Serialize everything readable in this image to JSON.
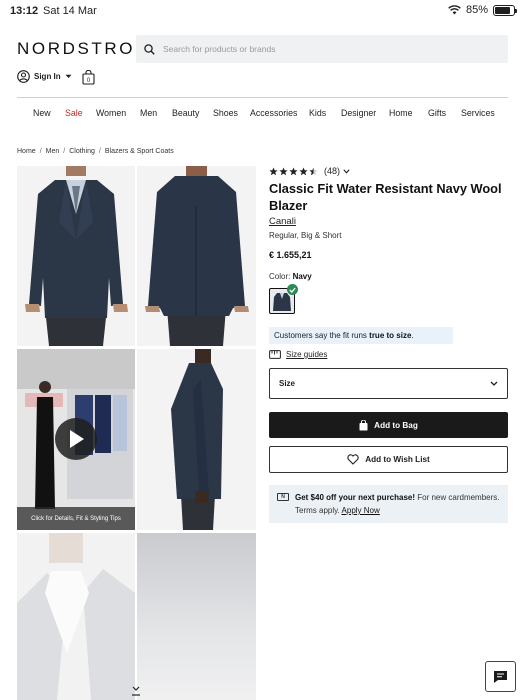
{
  "status_bar": {
    "time": "13:12",
    "date": "Sat 14 Mar",
    "battery": "85%"
  },
  "header": {
    "logo": "NORDSTROM",
    "search_placeholder": "Search for products or brands",
    "sign_in": "Sign In"
  },
  "nav": {
    "items": [
      {
        "label": "New"
      },
      {
        "label": "Sale"
      },
      {
        "label": "Women"
      },
      {
        "label": "Men"
      },
      {
        "label": "Beauty"
      },
      {
        "label": "Shoes"
      },
      {
        "label": "Accessories"
      },
      {
        "label": "Kids"
      },
      {
        "label": "Designer"
      },
      {
        "label": "Home"
      },
      {
        "label": "Gifts"
      },
      {
        "label": "Services"
      }
    ]
  },
  "breadcrumb": [
    "Home",
    "Men",
    "Clothing",
    "Blazers & Sport Coats"
  ],
  "gallery": {
    "video_caption": "Click for Details, Fit & Styling Tips"
  },
  "product": {
    "rating": 4.5,
    "review_count": "(48)",
    "title": "Classic Fit Water Resistant Navy Wool Blazer",
    "brand": "Canali",
    "fit_options": "Regular, Big & Short",
    "price": "€ 1.655,21",
    "color_label": "Color:",
    "color_value": "Navy",
    "fit_note_prefix": "Customers say the fit runs ",
    "fit_note_bold": "true to size",
    "fit_note_suffix": ".",
    "size_guides": "Size guides",
    "size_select": "Size",
    "add_to_bag": "Add to Bag",
    "add_to_wishlist": "Add to Wish List"
  },
  "promo": {
    "bold": "Get $40 off your next purchase!",
    "text": " For new cardmembers. Terms apply. ",
    "link": "Apply Now",
    "card_icon_text": "N"
  },
  "colors": {
    "navy": "#2b3647",
    "sale": "#c62828",
    "check_green": "#2b8a57",
    "fit_banner_bg": "#e9f1fa",
    "promo_bg": "#ecf1f6"
  }
}
